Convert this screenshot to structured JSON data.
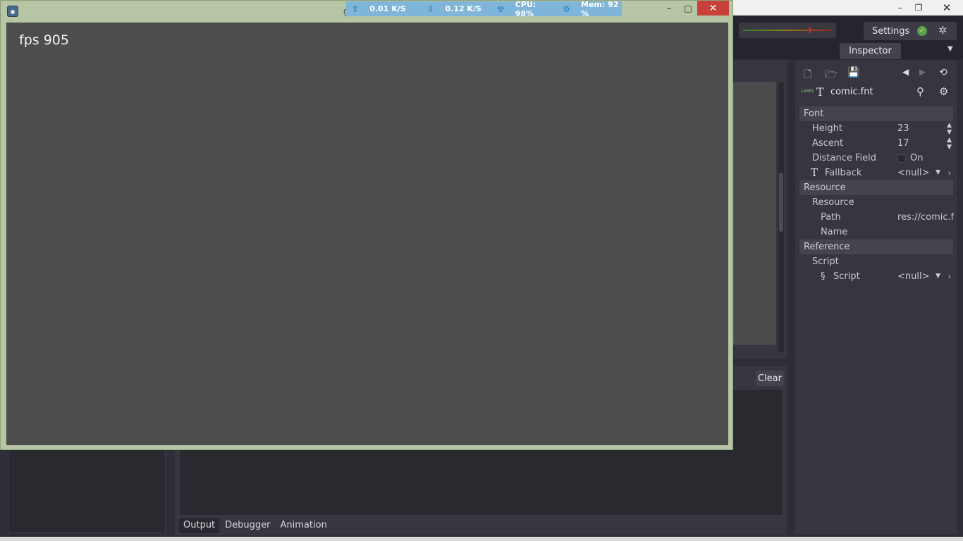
{
  "game_window": {
    "title": "g",
    "fps_text": "fps 905",
    "minimize": "–",
    "maximize": "□",
    "close": "✕"
  },
  "netmon": {
    "upload": "0.01 K/S",
    "download": "0.12 K/S",
    "cpu": "CPU: 98%",
    "mem": "Mem: 92 %"
  },
  "editor": {
    "settings_label": "Settings",
    "inspector_tab": "Inspector",
    "resource_name": "comic.fnt",
    "resource_type_badge": "LABEL",
    "sections": {
      "font": "Font",
      "resource": "Resource",
      "reference": "Reference"
    },
    "props": {
      "height_label": "Height",
      "height_value": "23",
      "ascent_label": "Ascent",
      "ascent_value": "17",
      "distance_label": "Distance Field",
      "distance_value": "On",
      "fallback_label": "Fallback",
      "fallback_value": "<null>",
      "resource_group": "Resource",
      "path_label": "Path",
      "path_value": "res://comic.f",
      "name_label": "Name",
      "script_group": "Script",
      "script_label": "Script",
      "script_value": "<null>"
    },
    "bottom": {
      "clear_label": "Clear",
      "tabs": [
        "Output",
        "Debugger",
        "Animation"
      ]
    }
  }
}
